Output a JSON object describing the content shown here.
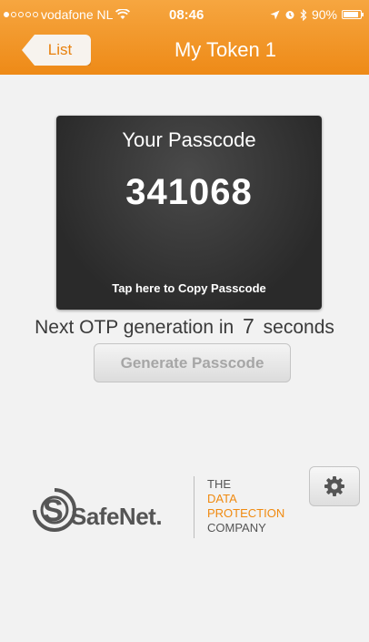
{
  "status_bar": {
    "carrier": "vodafone NL",
    "signal_bars_filled": 1,
    "signal_bars_total": 5,
    "time": "08:46",
    "battery_percent": "90%",
    "battery_level": 0.9
  },
  "nav": {
    "back_label": "List",
    "title": "My Token 1"
  },
  "passcode_card": {
    "heading": "Your Passcode",
    "passcode": "341068",
    "copy_hint": "Tap here to Copy Passcode"
  },
  "countdown": {
    "prefix": "Next OTP generation in",
    "seconds_value": "7",
    "suffix": "seconds"
  },
  "generate_button": {
    "label": "Generate Passcode"
  },
  "branding": {
    "logo_text": "SafeNet.",
    "tagline": [
      "THE",
      "DATA",
      "PROTECTION",
      "COMPANY"
    ]
  },
  "icons": {
    "settings": "gear-icon",
    "back": "chevron-left"
  },
  "colors": {
    "header": "#f19520",
    "accent": "#f08a10",
    "card": "#333333"
  }
}
